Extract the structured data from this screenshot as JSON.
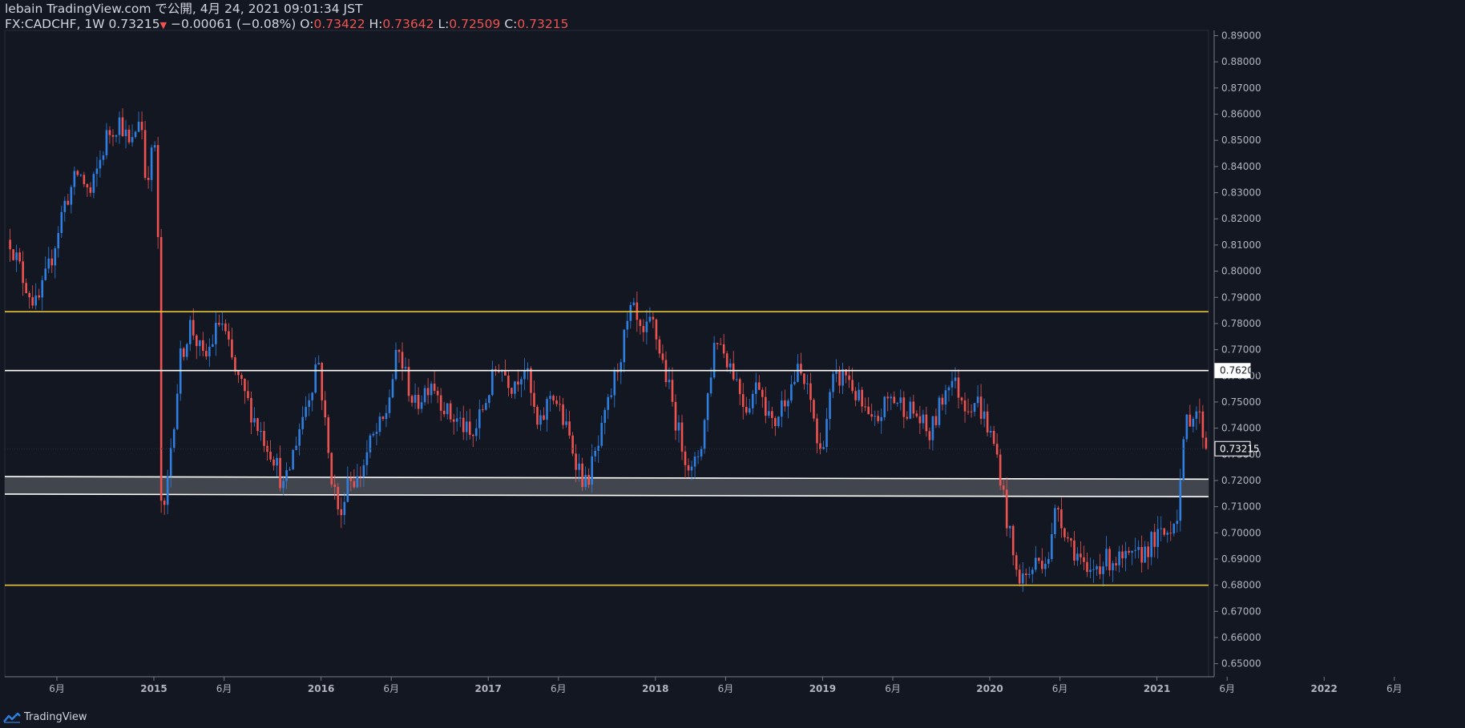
{
  "header": {
    "publisher_line": "lebain TradingView.com で公開, 4月 24, 2021 09:01:34 JST",
    "symbol": "FX:CADCHF, 1W",
    "last": "0.73215",
    "change_arrow": "▼",
    "change": "−0.00061 (−0.08%)",
    "o_label": "O:",
    "o": "0.73422",
    "h_label": "H:",
    "h": "0.73642",
    "l_label": "L:",
    "l": "0.72509",
    "c_label": "C:",
    "c": "0.73215"
  },
  "footer": {
    "brand": "TradingView"
  },
  "chart_data": {
    "type": "candlestick",
    "symbol": "FX:CADCHF",
    "interval": "1W",
    "ylim": [
      0.645,
      0.892
    ],
    "y_ticks": [
      "0.89000",
      "0.88000",
      "0.87000",
      "0.86000",
      "0.85000",
      "0.84000",
      "0.83000",
      "0.82000",
      "0.81000",
      "0.80000",
      "0.79000",
      "0.78000",
      "0.77000",
      "0.76000",
      "0.75000",
      "0.74000",
      "0.73000",
      "0.72000",
      "0.71000",
      "0.70000",
      "0.69000",
      "0.68000",
      "0.67000",
      "0.66000",
      "0.65000"
    ],
    "x_ticks": [
      {
        "label": "6月",
        "t": 2014.42
      },
      {
        "label": "2015",
        "t": 2015.0
      },
      {
        "label": "6月",
        "t": 2015.42
      },
      {
        "label": "2016",
        "t": 2016.0
      },
      {
        "label": "6月",
        "t": 2016.42
      },
      {
        "label": "2017",
        "t": 2017.0
      },
      {
        "label": "6月",
        "t": 2017.42
      },
      {
        "label": "2018",
        "t": 2018.0
      },
      {
        "label": "6月",
        "t": 2018.42
      },
      {
        "label": "2019",
        "t": 2019.0
      },
      {
        "label": "6月",
        "t": 2019.42
      },
      {
        "label": "2020",
        "t": 2020.0
      },
      {
        "label": "6月",
        "t": 2020.42
      },
      {
        "label": "2021",
        "t": 2021.0
      },
      {
        "label": "6月",
        "t": 2021.42
      },
      {
        "label": "2022",
        "t": 2022.0
      },
      {
        "label": "6月",
        "t": 2022.42
      }
    ],
    "price_labels": [
      {
        "text": "0.76200",
        "price": 0.762,
        "style": "white"
      },
      {
        "text": "0.73215",
        "price": 0.73215,
        "style": "dark"
      }
    ],
    "horizontal_lines": [
      {
        "price": 0.7845,
        "color": "#e3c43a"
      },
      {
        "price": 0.762,
        "color": "#ffffff"
      },
      {
        "price": 0.68,
        "color": "#e3c43a"
      }
    ],
    "zone": {
      "left_top": 0.7215,
      "left_bottom": 0.7148,
      "right_top": 0.7205,
      "right_bottom": 0.7138,
      "color": "#ffffff"
    },
    "current_price": 0.73215,
    "up_color": "#2f7fe0",
    "down_color": "#ef5350",
    "anchors": [
      [
        2014.14,
        0.812
      ],
      [
        2014.22,
        0.797
      ],
      [
        2014.3,
        0.786
      ],
      [
        2014.38,
        0.803
      ],
      [
        2014.46,
        0.825
      ],
      [
        2014.55,
        0.838
      ],
      [
        2014.62,
        0.829
      ],
      [
        2014.72,
        0.852
      ],
      [
        2014.8,
        0.858
      ],
      [
        2014.86,
        0.846
      ],
      [
        2014.92,
        0.862
      ],
      [
        2014.95,
        0.835
      ],
      [
        2015.02,
        0.852
      ],
      [
        2015.035,
        0.716
      ],
      [
        2015.06,
        0.705
      ],
      [
        2015.1,
        0.732
      ],
      [
        2015.16,
        0.767
      ],
      [
        2015.22,
        0.78
      ],
      [
        2015.3,
        0.765
      ],
      [
        2015.4,
        0.782
      ],
      [
        2015.48,
        0.762
      ],
      [
        2015.62,
        0.741
      ],
      [
        2015.72,
        0.729
      ],
      [
        2015.78,
        0.716
      ],
      [
        2015.86,
        0.738
      ],
      [
        2015.95,
        0.758
      ],
      [
        2015.98,
        0.769
      ],
      [
        2016.05,
        0.726
      ],
      [
        2016.12,
        0.704
      ],
      [
        2016.15,
        0.722
      ],
      [
        2016.22,
        0.72
      ],
      [
        2016.3,
        0.735
      ],
      [
        2016.38,
        0.743
      ],
      [
        2016.46,
        0.77
      ],
      [
        2016.56,
        0.748
      ],
      [
        2016.66,
        0.759
      ],
      [
        2016.76,
        0.745
      ],
      [
        2016.84,
        0.742
      ],
      [
        2016.9,
        0.735
      ],
      [
        2016.98,
        0.75
      ],
      [
        2017.06,
        0.765
      ],
      [
        2017.14,
        0.757
      ],
      [
        2017.22,
        0.764
      ],
      [
        2017.3,
        0.738
      ],
      [
        2017.38,
        0.755
      ],
      [
        2017.48,
        0.737
      ],
      [
        2017.58,
        0.718
      ],
      [
        2017.66,
        0.733
      ],
      [
        2017.76,
        0.76
      ],
      [
        2017.86,
        0.786
      ],
      [
        2017.92,
        0.773
      ],
      [
        2017.98,
        0.781
      ],
      [
        2018.06,
        0.761
      ],
      [
        2018.14,
        0.738
      ],
      [
        2018.22,
        0.722
      ],
      [
        2018.28,
        0.736
      ],
      [
        2018.36,
        0.776
      ],
      [
        2018.46,
        0.763
      ],
      [
        2018.54,
        0.748
      ],
      [
        2018.62,
        0.758
      ],
      [
        2018.7,
        0.74
      ],
      [
        2018.78,
        0.753
      ],
      [
        2018.86,
        0.762
      ],
      [
        2018.94,
        0.748
      ],
      [
        2018.98,
        0.728
      ],
      [
        2019.06,
        0.757
      ],
      [
        2019.14,
        0.761
      ],
      [
        2019.22,
        0.75
      ],
      [
        2019.3,
        0.74
      ],
      [
        2019.4,
        0.752
      ],
      [
        2019.48,
        0.749
      ],
      [
        2019.56,
        0.745
      ],
      [
        2019.64,
        0.737
      ],
      [
        2019.7,
        0.748
      ],
      [
        2019.76,
        0.76
      ],
      [
        2019.86,
        0.749
      ],
      [
        2019.92,
        0.751
      ],
      [
        2019.98,
        0.742
      ],
      [
        2020.05,
        0.728
      ],
      [
        2020.1,
        0.706
      ],
      [
        2020.16,
        0.684
      ],
      [
        2020.22,
        0.683
      ],
      [
        2020.28,
        0.689
      ],
      [
        2020.36,
        0.692
      ],
      [
        2020.4,
        0.712
      ],
      [
        2020.46,
        0.699
      ],
      [
        2020.54,
        0.69
      ],
      [
        2020.58,
        0.682
      ],
      [
        2020.64,
        0.688
      ],
      [
        2020.72,
        0.69
      ],
      [
        2020.8,
        0.689
      ],
      [
        2020.88,
        0.69
      ],
      [
        2020.96,
        0.696
      ],
      [
        2021.06,
        0.7
      ],
      [
        2021.12,
        0.708
      ],
      [
        2021.18,
        0.744
      ],
      [
        2021.24,
        0.747
      ],
      [
        2021.28,
        0.738
      ],
      [
        2021.3,
        0.7322
      ]
    ]
  }
}
